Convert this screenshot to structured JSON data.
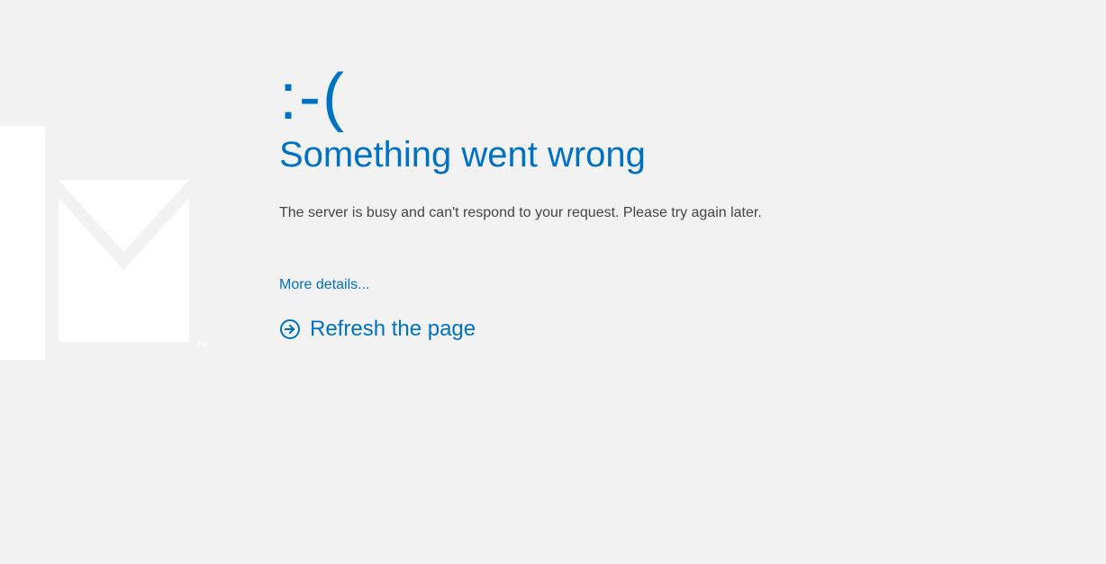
{
  "error": {
    "emoticon": ":-(",
    "headline": "Something went wrong",
    "message": "The server is busy and can't respond to your request. Please try again later.",
    "more_details_label": "More details...",
    "refresh_label": "Refresh the page"
  },
  "colors": {
    "accent": "#0072c6",
    "background": "#f2f2f2"
  }
}
